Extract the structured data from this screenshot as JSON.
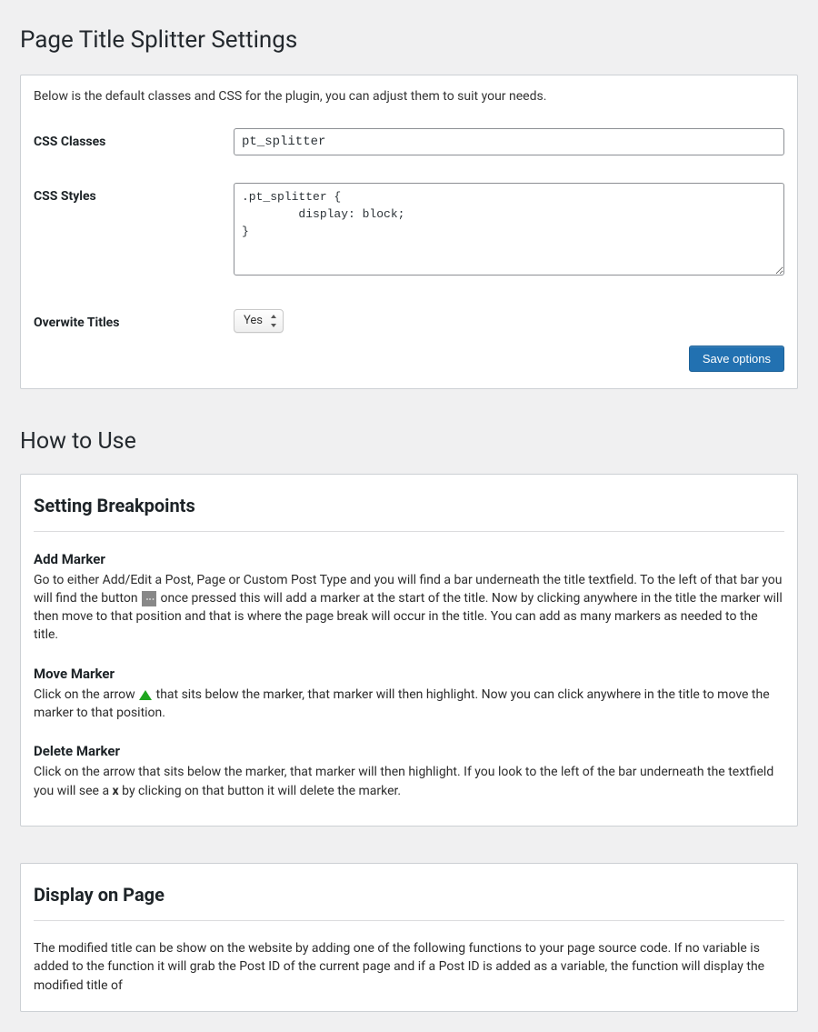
{
  "page": {
    "title": "Page Title Splitter Settings",
    "intro": "Below is the default classes and CSS for the plugin, you can adjust them to suit your needs."
  },
  "form": {
    "css_classes_label": "CSS Classes",
    "css_classes_value": "pt_splitter",
    "css_styles_label": "CSS Styles",
    "css_styles_value": ".pt_splitter {\n        display: block;\n}",
    "overwrite_label": "Overwite Titles",
    "overwrite_value": "Yes",
    "save_label": "Save options"
  },
  "howto": {
    "title": "How to Use",
    "breakpoints": {
      "title": "Setting Breakpoints",
      "add": {
        "title": "Add Marker",
        "pre": "Go to either Add/Edit a Post, Page or Custom Post Type and you will find a bar underneath the title textfield. To the left of that bar you will find the button ",
        "post": " once pressed this will add a marker at the start of the title. Now by clicking anywhere in the title the marker will then move to that position and that is where the page break will occur in the title. You can add as many markers as needed to the title."
      },
      "move": {
        "title": "Move Marker",
        "pre": "Click on the arrow ",
        "post": " that sits below the marker, that marker will then highlight. Now you can click anywhere in the title to move the marker to that position."
      },
      "delete": {
        "title": "Delete Marker",
        "pre": "Click on the arrow that sits below the marker, that marker will then highlight. If you look to the left of the bar underneath the textfield you will see a ",
        "x": "x",
        "post": " by clicking on that button it will delete the marker."
      }
    },
    "display": {
      "title": "Display on Page",
      "body": "The modified title can be show on the website by adding one of the following functions to your page source code. If no variable is added to the function it will grab the Post ID of the current page and if a Post ID is added as a variable, the function will display the modified title of"
    }
  },
  "icons": {
    "add_marker": "⋮"
  }
}
